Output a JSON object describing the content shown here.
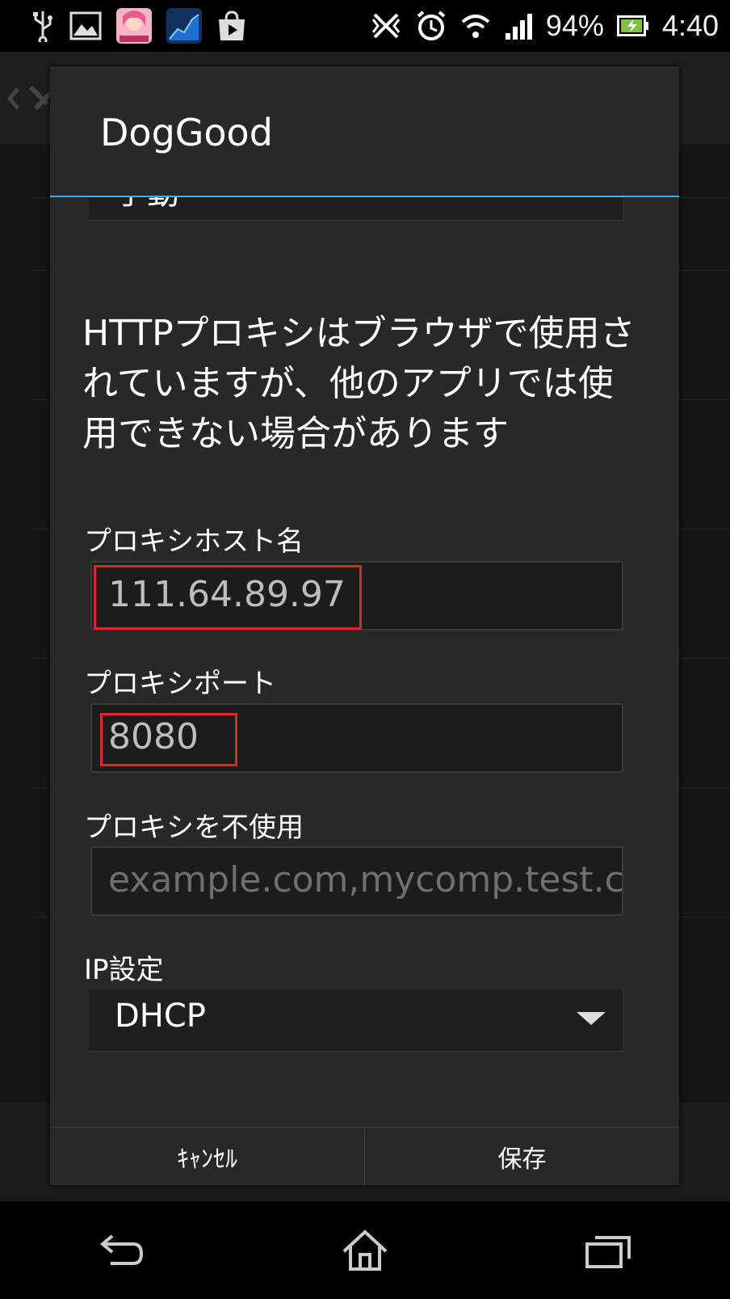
{
  "status_bar": {
    "icons_left": [
      "usb-icon",
      "image-icon",
      "game-app-icon",
      "chart-app-icon",
      "play-store-icon"
    ],
    "icons_right": [
      "nfc-off-icon",
      "alarm-icon",
      "wifi-icon",
      "signal-icon"
    ],
    "battery_percent": "94%",
    "time": "4:40"
  },
  "dialog": {
    "title": "DogGood",
    "proxy_mode_value": "手動",
    "info_text": "HTTPプロキシはブラウザで使用されていますが、他のアプリでは使用できない場合があります",
    "proxy_host": {
      "label": "プロキシホスト名",
      "value": "111.64.89.97"
    },
    "proxy_port": {
      "label": "プロキシポート",
      "value": "8080"
    },
    "proxy_bypass": {
      "label": "プロキシを不使用",
      "placeholder": "example.com,mycomp.test.c"
    },
    "ip_settings": {
      "label": "IP設定",
      "value": "DHCP"
    },
    "buttons": {
      "cancel": "ｷｬﾝｾﾙ",
      "save": "保存"
    }
  },
  "colors": {
    "accent": "#33b5e5",
    "highlight_box": "#e0262b"
  },
  "nav_bar": [
    "back-icon",
    "home-icon",
    "recent-apps-icon"
  ]
}
